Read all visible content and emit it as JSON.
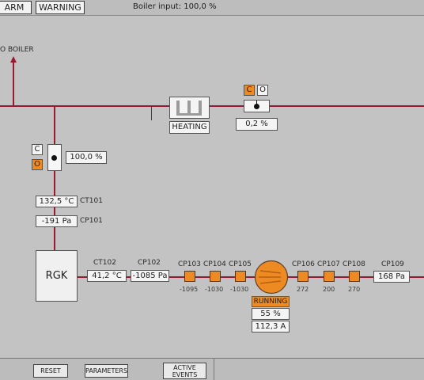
{
  "header": {
    "alarm_tab": "ARM",
    "warning_tab": "WARNING",
    "boiler_input": "Boiler input: 100,0 %"
  },
  "labels": {
    "to_boiler": "O BOILER",
    "heating": "HEATING",
    "rgk": "RGK",
    "running": "RUNNING"
  },
  "valve_top": {
    "c": "C",
    "o": "O",
    "value": "0,2 %"
  },
  "valve_left": {
    "c": "C",
    "o": "O",
    "value": "100,0 %"
  },
  "ct101": {
    "tag": "CT101",
    "value": "132,5 °C"
  },
  "cp101": {
    "tag": "CP101",
    "value": "-191 Pa"
  },
  "ct102": {
    "tag": "CT102",
    "value": "41,2 °C"
  },
  "cp102": {
    "tag": "CP102",
    "value": "-1085 Pa"
  },
  "cp103": {
    "tag": "CP103",
    "value": "-1095"
  },
  "cp104": {
    "tag": "CP104",
    "value": "-1030"
  },
  "cp105": {
    "tag": "CP105",
    "value": "-1030"
  },
  "cp106": {
    "tag": "CP106",
    "value": "272"
  },
  "cp107": {
    "tag": "CP107",
    "value": "200"
  },
  "cp108": {
    "tag": "CP108",
    "value": "270"
  },
  "cp109": {
    "tag": "CP109",
    "value": "168 Pa"
  },
  "fan": {
    "speed": "55 %",
    "current": "112,3 A"
  },
  "footer": {
    "reset": "RESET",
    "parameters": "PARAMETERS",
    "active_events_1": "ACTIVE",
    "active_events_2": "EVENTS"
  },
  "colors": {
    "pipe": "#9a1830",
    "accent": "#ee8a22",
    "background": "#c3c3c3"
  }
}
